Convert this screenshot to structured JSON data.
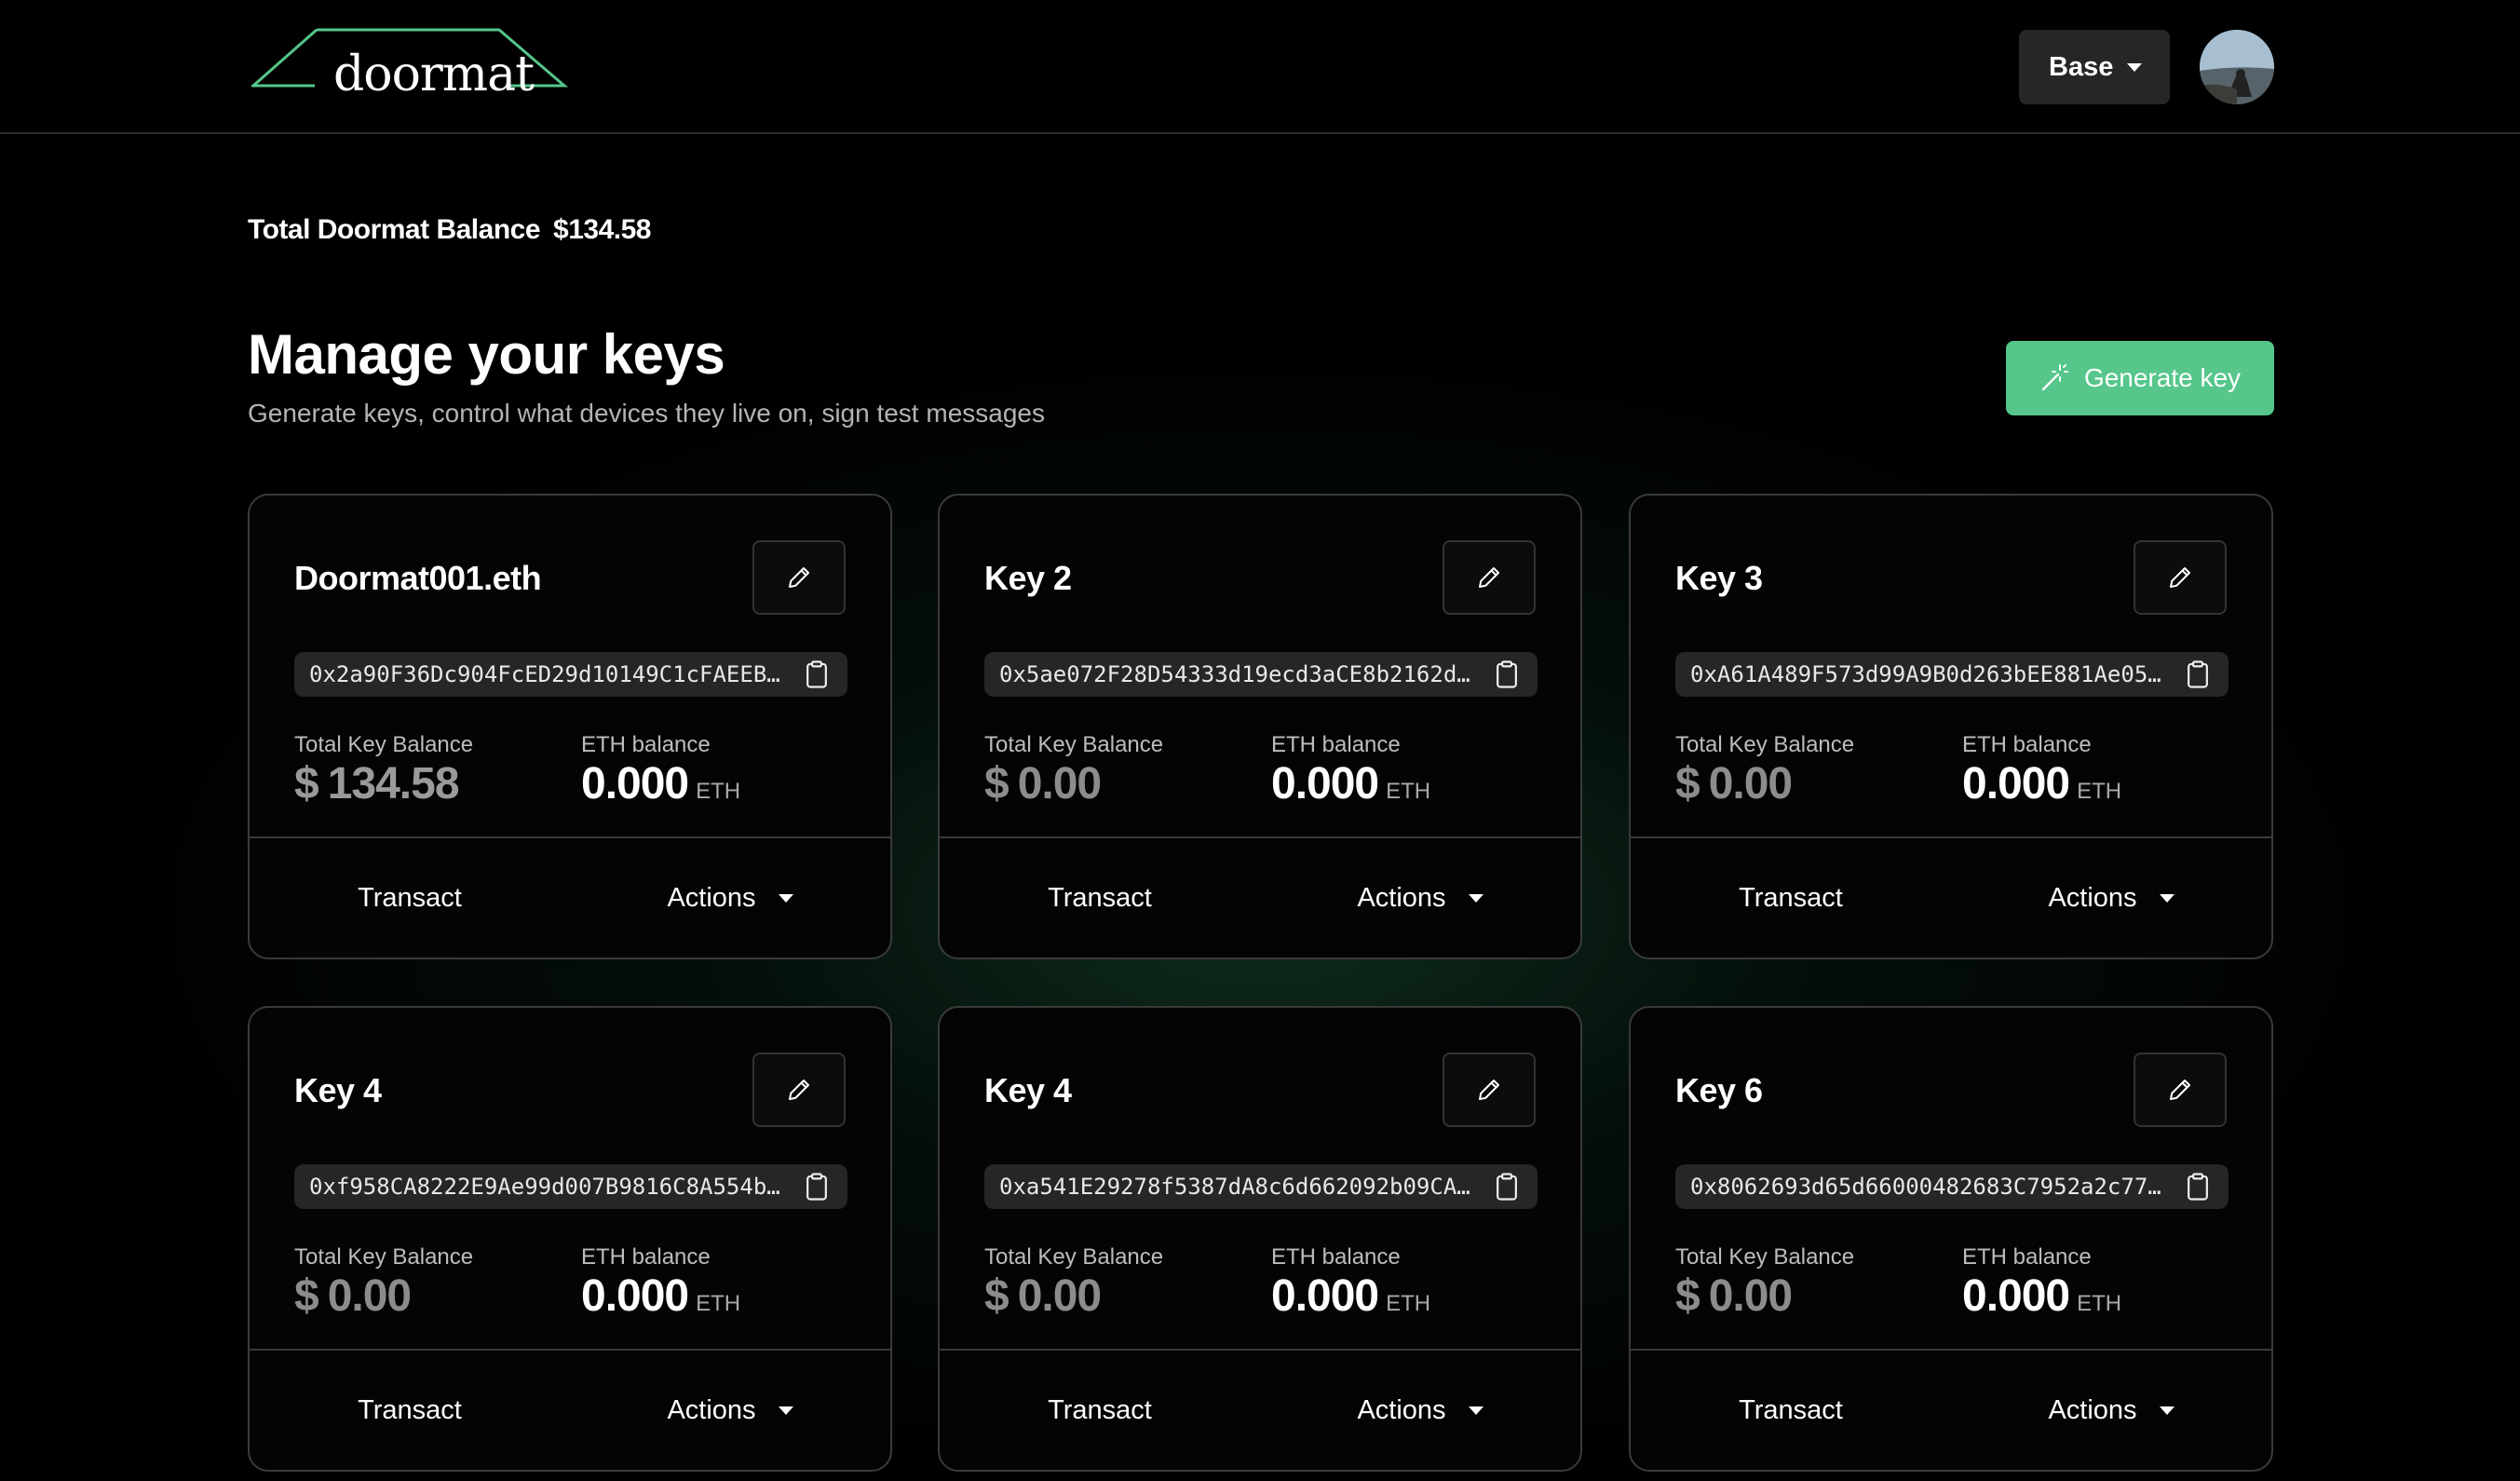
{
  "header": {
    "logo_text": "doormat",
    "network": "Base"
  },
  "summary": {
    "label": "Total Doormat Balance",
    "value": "$134.58"
  },
  "main": {
    "title": "Manage your keys",
    "subtitle": "Generate keys, control what devices they live on, sign test messages",
    "generate_label": "Generate key"
  },
  "card_labels": {
    "total_key_balance": "Total Key Balance",
    "eth_balance": "ETH balance",
    "currency": "$",
    "eth_unit": "ETH",
    "transact": "Transact",
    "actions": "Actions"
  },
  "keys": [
    {
      "name": "Doormat001.eth",
      "address": "0x2a90F36Dc904FcED29d10149C1cFAEEBB…",
      "usd": "134.58",
      "eth": "0.000"
    },
    {
      "name": "Key 2",
      "address": "0x5ae072F28D54333d19ecd3aCE8b2162d6…",
      "usd": "0.00",
      "eth": "0.000"
    },
    {
      "name": "Key 3",
      "address": "0xA61A489F573d99A9B0d263bEE881Ae05a…",
      "usd": "0.00",
      "eth": "0.000"
    },
    {
      "name": "Key 4",
      "address": "0xf958CA8222E9Ae99d007B9816C8A554bE…",
      "usd": "0.00",
      "eth": "0.000"
    },
    {
      "name": "Key 4",
      "address": "0xa541E29278f5387dA8c6d662092b09CA6…",
      "usd": "0.00",
      "eth": "0.000"
    },
    {
      "name": "Key 6",
      "address": "0x8062693d65d66000482683C7952a2c77d…",
      "usd": "0.00",
      "eth": "0.000"
    }
  ],
  "icons": {
    "edit": "pencil-icon",
    "copy": "clipboard-icon",
    "generate": "magic-wand-icon",
    "dropdown": "caret-down-icon"
  },
  "colors": {
    "accent": "#56c68b",
    "background": "#000000",
    "card_border": "#3a3a3a"
  }
}
